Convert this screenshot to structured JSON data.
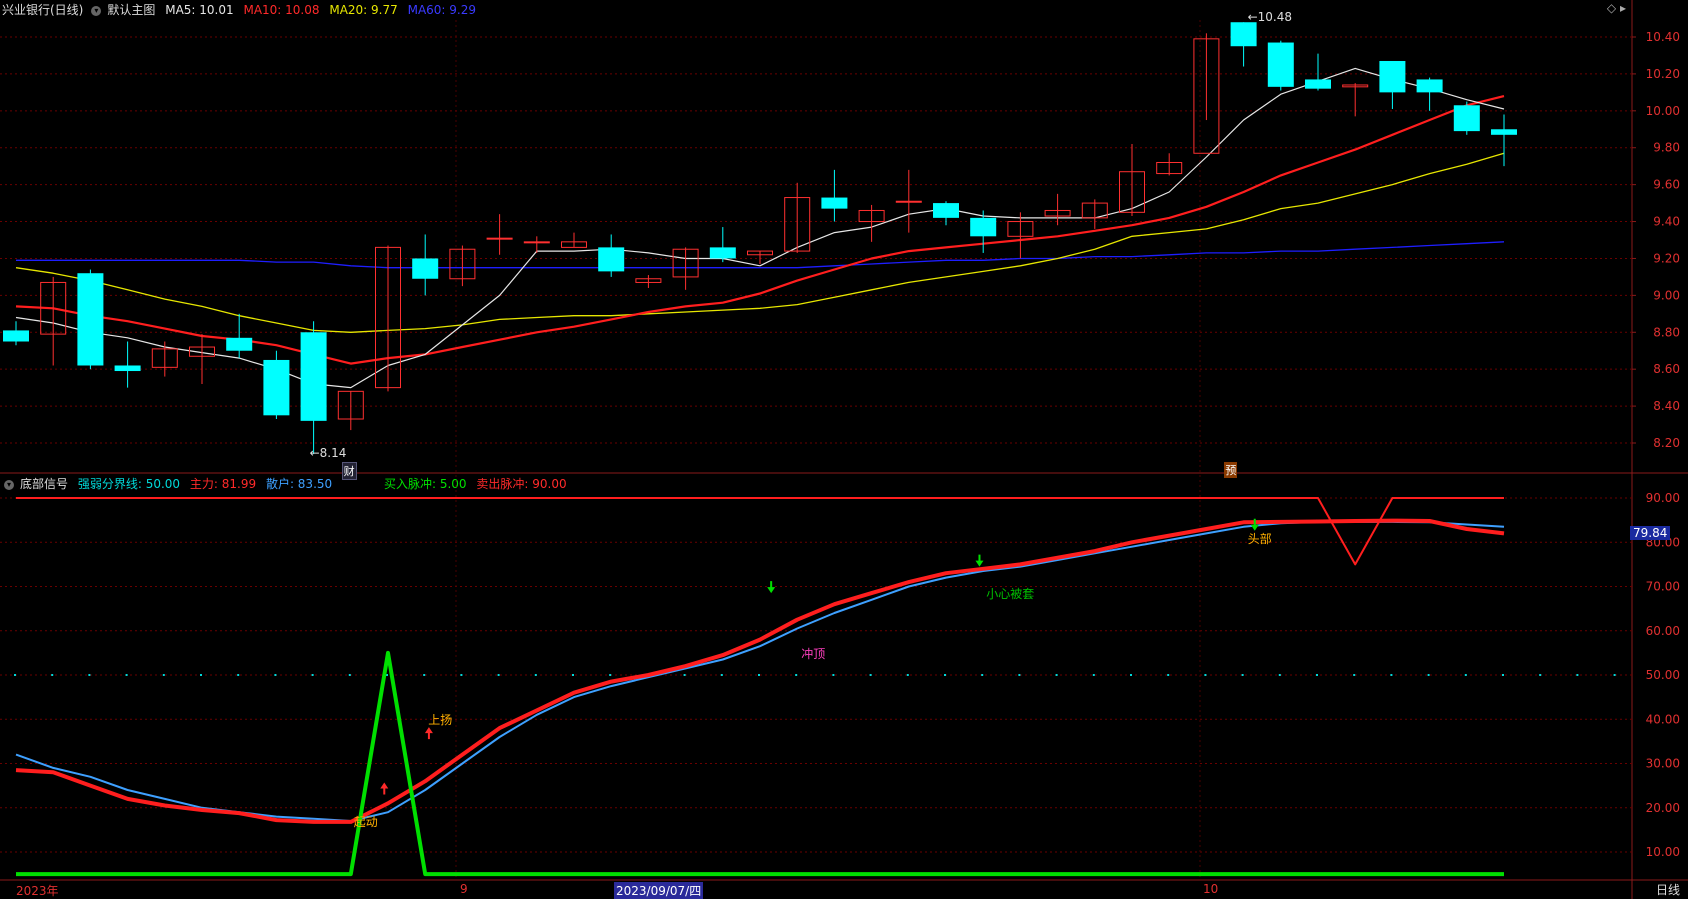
{
  "title_bar": {
    "stock": "兴业银行(日线)",
    "main_chart_label": "默认主图",
    "ma5": "MA5: 10.01",
    "ma10": "MA10: 10.08",
    "ma20": "MA20: 9.77",
    "ma60": "MA60: 9.29"
  },
  "indicator_bar": {
    "name": "底部信号",
    "strong_weak": "强弱分界线: 50.00",
    "main_force": "主力: 81.99",
    "retail": "散户: 83.50",
    "buy_pulse": "买入脉冲: 5.00",
    "sell_pulse": "卖出脉冲: 90.00"
  },
  "colors": {
    "up": "#ff3030",
    "down": "#00ffff",
    "ma5": "#e6e6e6",
    "ma10": "#ff1e1e",
    "ma20": "#e6e600",
    "ma60": "#1e1eff",
    "grid": "#6a0000",
    "axis_text": "#e03030",
    "main_force": "#ff1e1e",
    "retail": "#3ea0ff",
    "pulse": "#00e000"
  },
  "price_axis": [
    "10.40",
    "10.20",
    "10.00",
    "9.80",
    "9.60",
    "9.40",
    "9.20",
    "9.00",
    "8.80",
    "8.60",
    "8.40",
    "8.20"
  ],
  "indicator_axis": [
    "90.00",
    "80.00",
    "70.00",
    "60.00",
    "50.00",
    "40.00",
    "30.00",
    "20.00",
    "10.00"
  ],
  "price_annotations": {
    "high": "10.48",
    "low": "8.14",
    "cai_badge": "财",
    "yu_badge": "预"
  },
  "signal_labels": {
    "qidong": "起动",
    "shangyang": "上扬",
    "chongding": "冲顶",
    "xiaoxin": "小心被套",
    "toubu": "头部"
  },
  "current_value": "79.84",
  "x_axis": {
    "year": "2023年",
    "m9": "9",
    "cursor_date": "2023/09/07/四",
    "m10": "10"
  },
  "period_label": "日线",
  "chart_data": {
    "type": "candlestick",
    "ylim": [
      8.1,
      10.55
    ],
    "candles": [
      [
        8.81,
        8.75,
        8.86,
        8.73
      ],
      [
        8.79,
        9.07,
        9.1,
        8.62
      ],
      [
        9.12,
        8.62,
        9.14,
        8.6
      ],
      [
        8.62,
        8.59,
        8.75,
        8.5
      ],
      [
        8.61,
        8.71,
        8.75,
        8.56
      ],
      [
        8.67,
        8.72,
        8.79,
        8.52
      ],
      [
        8.77,
        8.7,
        8.9,
        8.66
      ],
      [
        8.65,
        8.35,
        8.7,
        8.33
      ],
      [
        8.8,
        8.32,
        8.86,
        8.14
      ],
      [
        8.33,
        8.48,
        8.48,
        8.27
      ],
      [
        8.5,
        9.26,
        9.27,
        8.48
      ],
      [
        9.2,
        9.09,
        9.33,
        9.0
      ],
      [
        9.09,
        9.25,
        9.27,
        9.05
      ],
      [
        9.31,
        9.31,
        9.44,
        9.22
      ],
      [
        9.29,
        9.29,
        9.32,
        9.23
      ],
      [
        9.26,
        9.29,
        9.34,
        9.26
      ],
      [
        9.26,
        9.13,
        9.33,
        9.1
      ],
      [
        9.07,
        9.09,
        9.11,
        9.04
      ],
      [
        9.1,
        9.25,
        9.26,
        9.03
      ],
      [
        9.26,
        9.2,
        9.37,
        9.18
      ],
      [
        9.22,
        9.24,
        9.24,
        9.17
      ],
      [
        9.24,
        9.53,
        9.61,
        9.23
      ],
      [
        9.53,
        9.47,
        9.68,
        9.4
      ],
      [
        9.4,
        9.46,
        9.49,
        9.29
      ],
      [
        9.51,
        9.51,
        9.68,
        9.34
      ],
      [
        9.5,
        9.42,
        9.51,
        9.38
      ],
      [
        9.42,
        9.32,
        9.46,
        9.23
      ],
      [
        9.32,
        9.4,
        9.45,
        9.2
      ],
      [
        9.43,
        9.46,
        9.55,
        9.38
      ],
      [
        9.42,
        9.5,
        9.52,
        9.36
      ],
      [
        9.45,
        9.67,
        9.82,
        9.43
      ],
      [
        9.66,
        9.72,
        9.77,
        9.65
      ],
      [
        9.77,
        10.39,
        10.42,
        9.95
      ],
      [
        10.48,
        10.35,
        10.48,
        10.24
      ],
      [
        10.37,
        10.13,
        10.38,
        10.11
      ],
      [
        10.17,
        10.12,
        10.31,
        10.11
      ],
      [
        10.13,
        10.14,
        10.15,
        9.97
      ],
      [
        10.27,
        10.1,
        10.27,
        10.01
      ],
      [
        10.17,
        10.1,
        10.18,
        10.0
      ],
      [
        10.03,
        9.89,
        10.05,
        9.87
      ],
      [
        9.9,
        9.87,
        9.98,
        9.7
      ]
    ],
    "ma5": [
      8.88,
      8.85,
      8.8,
      8.77,
      8.72,
      8.69,
      8.66,
      8.6,
      8.52,
      8.5,
      8.62,
      8.68,
      8.84,
      9.0,
      9.24,
      9.24,
      9.25,
      9.23,
      9.2,
      9.2,
      9.16,
      9.26,
      9.34,
      9.37,
      9.44,
      9.47,
      9.43,
      9.42,
      9.42,
      9.42,
      9.47,
      9.56,
      9.75,
      9.95,
      10.09,
      10.16,
      10.23,
      10.17,
      10.12,
      10.06,
      10.01
    ],
    "ma10": [
      8.94,
      8.93,
      8.89,
      8.86,
      8.82,
      8.78,
      8.76,
      8.73,
      8.68,
      8.63,
      8.66,
      8.68,
      8.72,
      8.76,
      8.8,
      8.83,
      8.87,
      8.91,
      8.94,
      8.96,
      9.01,
      9.08,
      9.14,
      9.2,
      9.24,
      9.26,
      9.28,
      9.3,
      9.32,
      9.35,
      9.38,
      9.42,
      9.48,
      9.56,
      9.65,
      9.72,
      9.79,
      9.87,
      9.95,
      10.03,
      10.08
    ],
    "ma20": [
      9.15,
      9.12,
      9.08,
      9.03,
      8.98,
      8.94,
      8.89,
      8.85,
      8.81,
      8.8,
      8.81,
      8.82,
      8.84,
      8.87,
      8.88,
      8.89,
      8.89,
      8.9,
      8.91,
      8.92,
      8.93,
      8.95,
      8.99,
      9.03,
      9.07,
      9.1,
      9.13,
      9.16,
      9.2,
      9.25,
      9.32,
      9.34,
      9.36,
      9.41,
      9.47,
      9.5,
      9.55,
      9.6,
      9.66,
      9.71,
      9.77
    ],
    "ma60": [
      9.19,
      9.19,
      9.19,
      9.19,
      9.19,
      9.19,
      9.19,
      9.18,
      9.18,
      9.16,
      9.15,
      9.15,
      9.15,
      9.15,
      9.15,
      9.15,
      9.15,
      9.15,
      9.15,
      9.15,
      9.15,
      9.15,
      9.16,
      9.17,
      9.18,
      9.19,
      9.19,
      9.2,
      9.2,
      9.21,
      9.21,
      9.22,
      9.23,
      9.23,
      9.24,
      9.24,
      9.25,
      9.26,
      9.27,
      9.28,
      9.29
    ],
    "indicator": {
      "ylim": [
        3,
        93
      ],
      "main_force": [
        28.5,
        28,
        25,
        22,
        20.5,
        19.5,
        18.8,
        17.2,
        16.8,
        16.8,
        21,
        26,
        32,
        38,
        42,
        46,
        48.5,
        50,
        52,
        54.5,
        58,
        62.5,
        66,
        68.5,
        71,
        73,
        74,
        75,
        76.5,
        78,
        80,
        81.5,
        83,
        84.5,
        84.6,
        84.7,
        84.8,
        84.9,
        84.8,
        83,
        82
      ],
      "retail": [
        32,
        29,
        27,
        24,
        22,
        20,
        19,
        18,
        17.5,
        17,
        19,
        24,
        30,
        36,
        41,
        45,
        47.5,
        49.5,
        51.5,
        53.5,
        56.5,
        60.5,
        64,
        67,
        70,
        72,
        73.5,
        74.5,
        76,
        77.5,
        79,
        80.5,
        82,
        83.5,
        84.3,
        84.6,
        84.6,
        84.6,
        84.5,
        84,
        83.5
      ],
      "buy_pulse": [
        5,
        5,
        5,
        5,
        5,
        5,
        5,
        5,
        5,
        5,
        55,
        5,
        5,
        5,
        5,
        5,
        5,
        5,
        5,
        5,
        5,
        5,
        5,
        5,
        5,
        5,
        5,
        5,
        5,
        5,
        5,
        5,
        5,
        5,
        5,
        5,
        5,
        5,
        5,
        5,
        5
      ],
      "sell_pulse": [
        90,
        90,
        90,
        90,
        90,
        90,
        90,
        90,
        90,
        90,
        90,
        90,
        90,
        90,
        90,
        90,
        90,
        90,
        90,
        90,
        90,
        90,
        90,
        90,
        90,
        90,
        90,
        90,
        90,
        90,
        90,
        90,
        90,
        90,
        90,
        90,
        75,
        90,
        90,
        90,
        90
      ],
      "strong_weak": 50
    }
  }
}
